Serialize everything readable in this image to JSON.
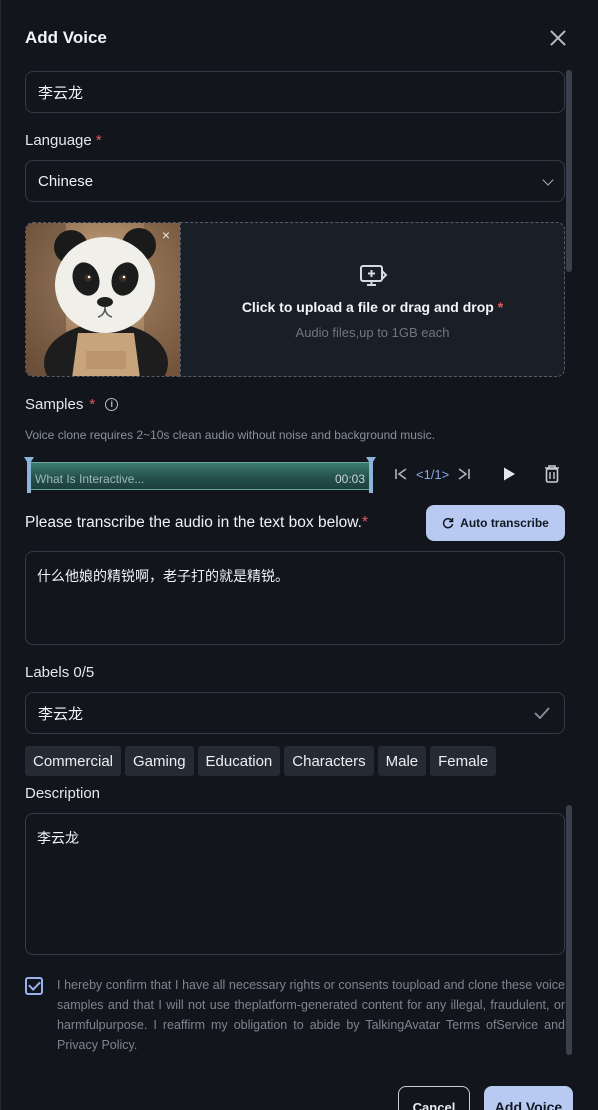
{
  "dialog": {
    "title": "Add Voice"
  },
  "name_field": {
    "value": "李云龙"
  },
  "language": {
    "label": "Language",
    "required_mark": "*",
    "value": "Chinese"
  },
  "upload": {
    "title": "Click to upload a file or drag and drop",
    "required_mark": "*",
    "subtitle": "Audio files,up to 1GB each",
    "thumbnail_close": "×"
  },
  "samples": {
    "label": "Samples",
    "required_mark": "*",
    "info_glyph": "i",
    "hint": "Voice clone requires 2~10s clean audio without noise and background music.",
    "clip_name": "What Is Interactive...",
    "clip_time": "00:03",
    "pager": "<1/1>"
  },
  "transcribe": {
    "label": "Please transcribe the audio in the text box below.",
    "required_mark": "*",
    "auto_button": "Auto transcribe",
    "text": "什么他娘的精锐啊，老子打的就是精锐。"
  },
  "labels": {
    "label": "Labels 0/5",
    "value": "李云龙",
    "chips": [
      "Commercial",
      "Gaming",
      "Education",
      "Characters",
      "Male",
      "Female"
    ]
  },
  "description": {
    "label": "Description",
    "value": "李云龙"
  },
  "consent": {
    "checked": true,
    "text": "I hereby confirm that I have all necessary rights or consents toupload and clone these voice samples and that I will not use theplatform-generated content for any illegal, fraudulent, or harmfulpurpose. I reaffirm my obligation to abide by TalkingAvatar Terms ofService and Privacy Policy."
  },
  "footer": {
    "cancel": "Cancel",
    "submit": "Add Voice"
  },
  "colors": {
    "accent": "#b8c9f2",
    "required": "#e65a5a",
    "background": "#12151b",
    "wave": "#2f6b64"
  },
  "icons": [
    "close-icon",
    "chevron-down-icon",
    "upload-screen-icon",
    "info-icon",
    "skip-back-icon",
    "skip-forward-icon",
    "play-icon",
    "trash-icon",
    "refresh-icon",
    "check-icon"
  ]
}
